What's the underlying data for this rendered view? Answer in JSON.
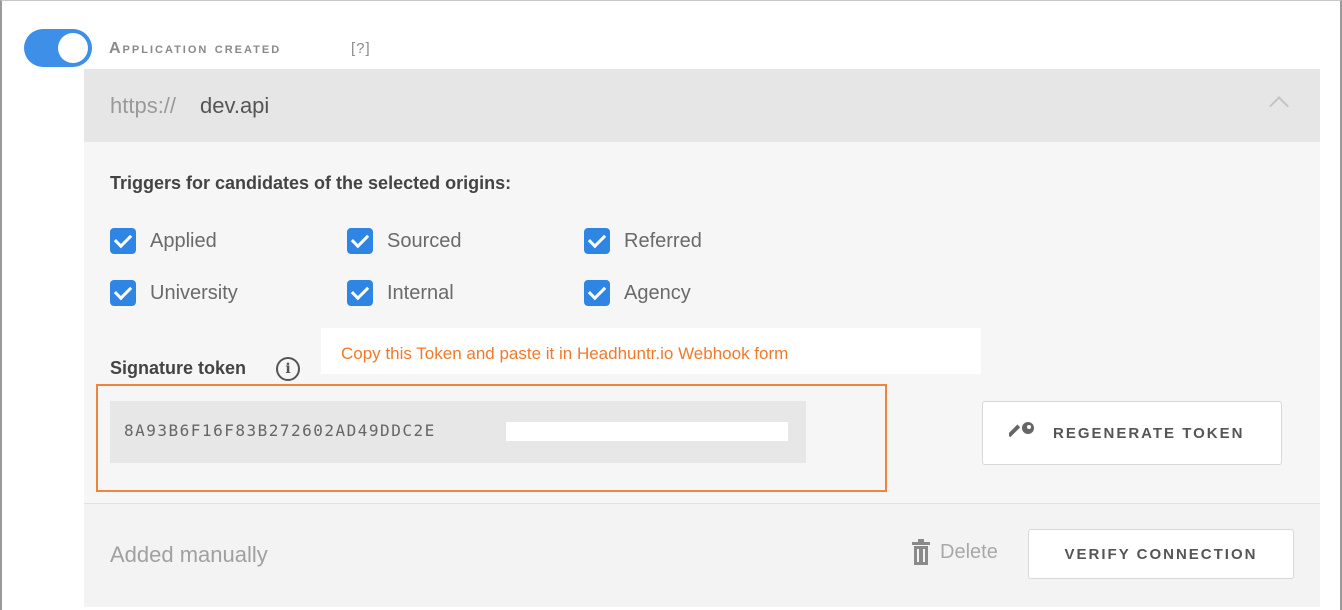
{
  "webhook": {
    "enabled": true,
    "event_title": "Application created",
    "help_link": "[?]",
    "url_prefix": "https://",
    "url_host": "dev.api"
  },
  "triggers": {
    "heading": "Triggers for candidates of the selected origins:",
    "options": [
      {
        "label": "Applied",
        "checked": true
      },
      {
        "label": "Sourced",
        "checked": true
      },
      {
        "label": "Referred",
        "checked": true
      },
      {
        "label": "University",
        "checked": true
      },
      {
        "label": "Internal",
        "checked": true
      },
      {
        "label": "Agency",
        "checked": true
      }
    ]
  },
  "signature": {
    "label": "Signature token",
    "note": "Copy this Token and paste it in Headhuntr.io Webhook form",
    "token": "8A93B6F16F83B272602AD49DDC2E",
    "regenerate_label": "REGENERATE TOKEN"
  },
  "footer": {
    "status": "Added manually",
    "delete_label": "Delete",
    "verify_label": "VERIFY CONNECTION"
  },
  "colors": {
    "accent": "#3d8fe8",
    "note": "#f07a2a",
    "highlight": "#f0843a"
  },
  "icons": [
    "info-icon",
    "key-icon",
    "trash-icon",
    "chevron-up-icon",
    "check-icon"
  ]
}
